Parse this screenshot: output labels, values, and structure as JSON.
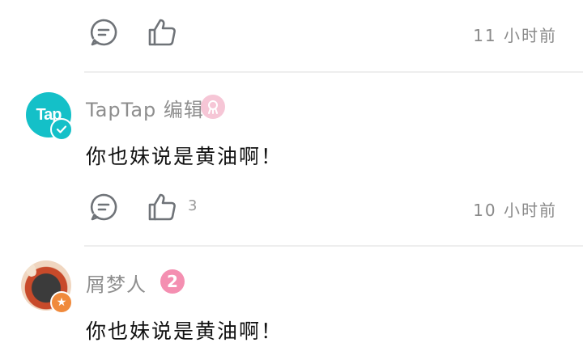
{
  "comments": [
    {
      "time": "11 小时前",
      "like_count": ""
    },
    {
      "author": "TapTap 编辑",
      "avatar_text": "Tap",
      "text": "你也妹说是黄油啊！",
      "like_count": "3",
      "time": "10 小时前"
    },
    {
      "author": "屑梦人",
      "level": "2",
      "text": "你也妹说是黄油啊！"
    }
  ],
  "icons": {
    "comment": "comment-icon",
    "like": "thumbs-up-icon",
    "verified": "verified-check-icon",
    "editor_badge": "editor-badge-icon",
    "star": "star-badge-icon"
  },
  "colors": {
    "taptap_teal": "#14c0c8",
    "level_pink": "#f48fb1",
    "icon_gray": "#6f7378"
  }
}
